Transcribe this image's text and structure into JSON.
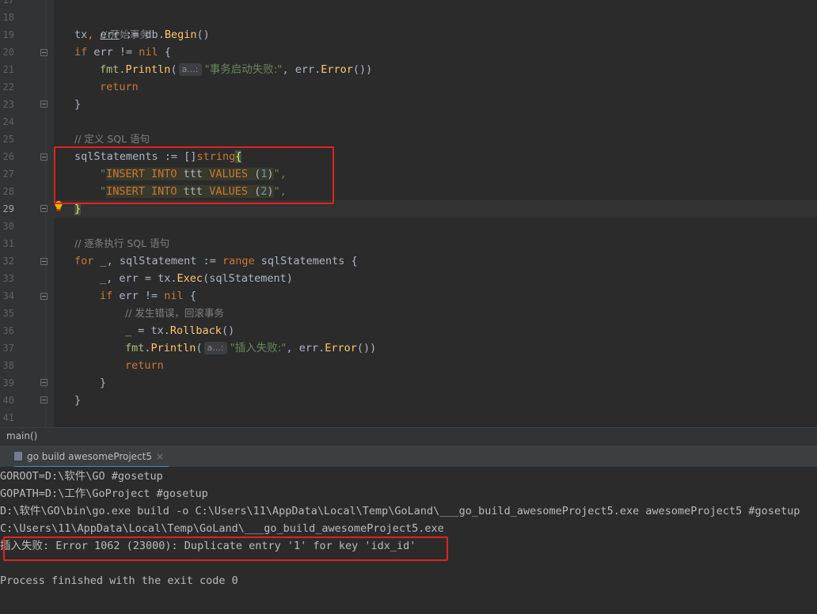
{
  "editor": {
    "line_numbers": [
      "17",
      "18",
      "19",
      "20",
      "21",
      "22",
      "23",
      "24",
      "25",
      "26",
      "27",
      "28",
      "29",
      "30",
      "31",
      "32",
      "33",
      "34",
      "35",
      "36",
      "37",
      "38",
      "39",
      "40",
      "41"
    ],
    "current_line": "29",
    "code": {
      "l18_comment": "// 开始事务",
      "l19_tx": "tx",
      "l19_err": "err",
      "l19_assign": " := db.",
      "l19_method": "Begin",
      "l19_tail": "()",
      "kw_if": "if",
      "kw_nil": "nil",
      "kw_return": "return",
      "kw_for": "for",
      "kw_range": "range",
      "kw_string": "string",
      "err_neq": " err != ",
      "open_brace": " {",
      "close_brace": "}",
      "pkg_fmt": "fmt",
      "dot": ".",
      "println": "Println",
      "paren_open": "(",
      "hint_a": "a...:",
      "l21_str": "\"事务启动失败:\"",
      "comma_err": ", err.",
      "error_m": "Error",
      "parens_close": "())",
      "l25_comment": "// 定义 SQL 语句",
      "l26_left": "sqlStatements := []",
      "l26_brace": "{",
      "quote": "\"",
      "sql_insert": "INSERT INTO",
      "sql_ttt": " ttt ",
      "sql_values": "VALUES",
      "sql_open": " (",
      "sql_val1": "1",
      "sql_val2": "2",
      "sql_close": ")",
      "quote_comma": "\",",
      "l31_comment": "// 逐条执行 SQL 语句",
      "l32_mid": " _, sqlStatement := ",
      "l32_tail": " sqlStatements {",
      "l33_left": "_, err = tx.",
      "exec": "Exec",
      "l33_tail": "(sqlStatement)",
      "l35_comment": "// 发生错误，回滚事务",
      "l36_left": "_ = tx.",
      "rollback": "Rollback",
      "l36_tail": "()",
      "l37_str": "\"插入失败:\""
    }
  },
  "breadcrumb": {
    "label": "main()"
  },
  "run_panel": {
    "tab_label": "go build awesomeProject5",
    "close_glyph": "×",
    "console_lines": [
      "GOROOT=D:\\软件\\GO #gosetup",
      "GOPATH=D:\\工作\\GoProject #gosetup",
      "D:\\软件\\GO\\bin\\go.exe build -o C:\\Users\\11\\AppData\\Local\\Temp\\GoLand\\___go_build_awesomeProject5.exe awesomeProject5 #gosetup",
      "C:\\Users\\11\\AppData\\Local\\Temp\\GoLand\\___go_build_awesomeProject5.exe",
      "插入失败: Error 1062 (23000): Duplicate entry '1' for key 'idx_id'",
      "",
      "Process finished with the exit code 0"
    ]
  },
  "colors": {
    "keyword": "#cc7832",
    "string": "#6a8759",
    "number": "#6897bb",
    "method": "#ffc66d",
    "comment": "#808080",
    "highlight_box": "#e0231d"
  }
}
